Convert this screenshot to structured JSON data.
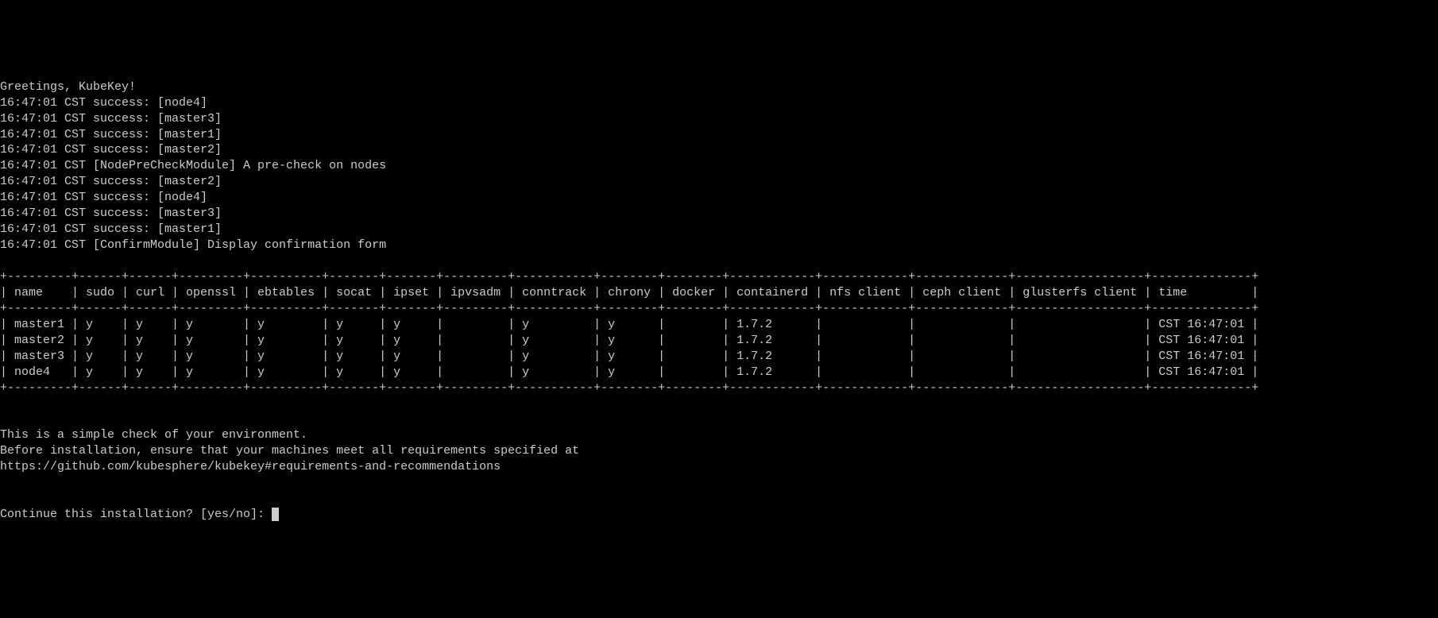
{
  "log_lines": [
    "Greetings, KubeKey!",
    "16:47:01 CST success: [node4]",
    "16:47:01 CST success: [master3]",
    "16:47:01 CST success: [master1]",
    "16:47:01 CST success: [master2]",
    "16:47:01 CST [NodePreCheckModule] A pre-check on nodes",
    "16:47:01 CST success: [master2]",
    "16:47:01 CST success: [node4]",
    "16:47:01 CST success: [master3]",
    "16:47:01 CST success: [master1]",
    "16:47:01 CST [ConfirmModule] Display confirmation form"
  ],
  "table": {
    "columns": [
      "name",
      "sudo",
      "curl",
      "openssl",
      "ebtables",
      "socat",
      "ipset",
      "ipvsadm",
      "conntrack",
      "chrony",
      "docker",
      "containerd",
      "nfs client",
      "ceph client",
      "glusterfs client",
      "time"
    ],
    "widths": [
      9,
      6,
      6,
      9,
      10,
      7,
      7,
      9,
      11,
      8,
      8,
      12,
      12,
      13,
      18,
      14
    ],
    "rows": [
      {
        "name": "master1",
        "sudo": "y",
        "curl": "y",
        "openssl": "y",
        "ebtables": "y",
        "socat": "y",
        "ipset": "y",
        "ipvsadm": "",
        "conntrack": "y",
        "chrony": "y",
        "docker": "",
        "containerd": "1.7.2",
        "nfs_client": "",
        "ceph_client": "",
        "glusterfs_client": "",
        "time": "CST 16:47:01"
      },
      {
        "name": "master2",
        "sudo": "y",
        "curl": "y",
        "openssl": "y",
        "ebtables": "y",
        "socat": "y",
        "ipset": "y",
        "ipvsadm": "",
        "conntrack": "y",
        "chrony": "y",
        "docker": "",
        "containerd": "1.7.2",
        "nfs_client": "",
        "ceph_client": "",
        "glusterfs_client": "",
        "time": "CST 16:47:01"
      },
      {
        "name": "master3",
        "sudo": "y",
        "curl": "y",
        "openssl": "y",
        "ebtables": "y",
        "socat": "y",
        "ipset": "y",
        "ipvsadm": "",
        "conntrack": "y",
        "chrony": "y",
        "docker": "",
        "containerd": "1.7.2",
        "nfs_client": "",
        "ceph_client": "",
        "glusterfs_client": "",
        "time": "CST 16:47:01"
      },
      {
        "name": "node4",
        "sudo": "y",
        "curl": "y",
        "openssl": "y",
        "ebtables": "y",
        "socat": "y",
        "ipset": "y",
        "ipvsadm": "",
        "conntrack": "y",
        "chrony": "y",
        "docker": "",
        "containerd": "1.7.2",
        "nfs_client": "",
        "ceph_client": "",
        "glusterfs_client": "",
        "time": "CST 16:47:01"
      }
    ]
  },
  "info_lines": [
    "",
    "This is a simple check of your environment.",
    "Before installation, ensure that your machines meet all requirements specified at",
    "https://github.com/kubesphere/kubekey#requirements-and-recommendations",
    ""
  ],
  "prompt": "Continue this installation? [yes/no]: "
}
